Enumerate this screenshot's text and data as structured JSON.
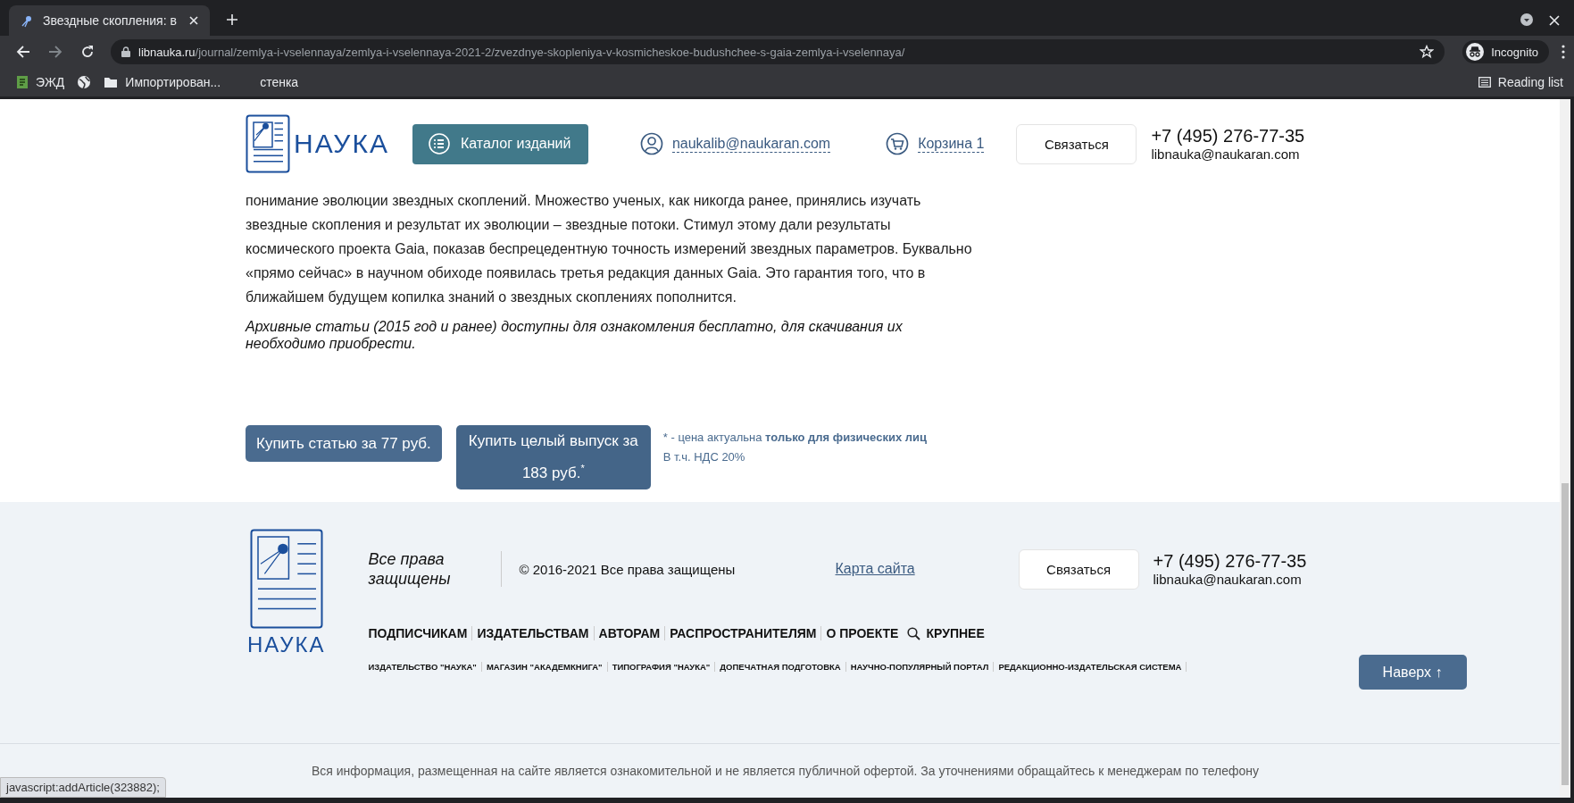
{
  "browser": {
    "tab": {
      "title": "Звездные скопления: в",
      "selected": true
    },
    "url_host": "libnauka.ru",
    "url_path": "/journal/zemlya-i-vselennaya/zemlya-i-vselennaya-2021-2/zvezdnye-skopleniya-v-kosmicheskoe-budushchee-s-gaia-zemlya-i-vselennaya/",
    "profile": "Incognito",
    "bookmarks": [
      {
        "kind": "app",
        "label": "ЭЖД"
      },
      {
        "kind": "globe"
      },
      {
        "kind": "folder",
        "label": "Импортирован..."
      },
      {
        "kind": "plain",
        "label": "стенка"
      }
    ],
    "reading_list": "Reading list"
  },
  "header": {
    "logo": "НАУКА",
    "catalog_button": "Каталог изданий",
    "account_email": "naukalib@naukaran.com",
    "cart": "Корзина 1",
    "contact_button": "Связаться",
    "phone": "+7 (495) 276-77-35",
    "email": "libnauka@naukaran.com"
  },
  "article": {
    "lines": [
      "понимание эволюции звездных скоплений. Множество ученых, как никогда ранее, принялись изучать",
      "звездные скопления и результат их эволюции – звездные потоки. Стимул этому дали результаты",
      "космического проекта Gaia, показав беспрецедентную точность измерений звездных параметров. Буквально",
      "«прямо сейчас» в научном обиходе появилась третья редакция данных Gaia. Это гарантия того, что в",
      "ближайшем будущем копилка знаний о звездных скоплениях пополнится."
    ],
    "note": "Архивные статьи (2015 год и ранее) доступны для ознакомления бесплатно, для скачивания их необходимо приобрести.",
    "buy_article": "Купить статью за 77 руб.",
    "buy_issue": "Купить целый выпуск за 183 руб.$^{*}$",
    "price_note": "* - цена актуальна **только для физических лиц**",
    "vat_note": "В т.ч. НДС 20%"
  },
  "footer": {
    "logo": "НАУКА",
    "rights_title": "Все права защищены",
    "copyright": "© 2016-2021 Все права защищены",
    "sitemap": "Карта сайта",
    "contact_button": "Связаться",
    "phone": "+7 (495) 276-77-35",
    "email": "libnauka@naukaran.com",
    "menu": [
      "ПОДПИСЧИКАМ",
      "ИЗДАТЕЛЬСТВАМ",
      "АВТОРАМ",
      "РАСПРОСТРАНИТЕЛЯМ",
      "О ПРОЕКТЕ"
    ],
    "larger": "КРУПНЕЕ",
    "links": [
      "ИЗДАТЕЛЬСТВО \"НАУКА\"",
      "МАГАЗИН \"АКАДЕМКНИГА\"",
      "ТИПОГРАФИЯ \"НАУКА\"",
      "ДОПЕЧАТНАЯ ПОДГОТОВКА",
      "НАУЧНО-ПОПУЛЯРНЫЙ ПОРТАЛ",
      "РЕДАКЦИОННО-ИЗДАТЕЛЬСКАЯ СИСТЕМА"
    ],
    "top_button": "Наверх ↑",
    "disclaimer": "Вся информация, размещенная на сайте является ознакомительной и не является публичной офертой. За уточнениями обращайтесь к менеджерам по телефону"
  },
  "status_url": "javascript:addArticle(323882);"
}
